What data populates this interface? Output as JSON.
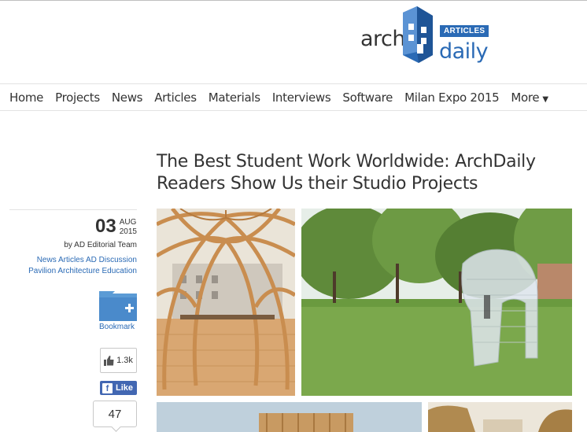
{
  "logo": {
    "word1": "arch",
    "word2": "daily",
    "badge": "ARTICLES",
    "icon": "archdaily-building-icon",
    "brand_color": "#2a6ab5"
  },
  "nav": {
    "items": [
      "Home",
      "Projects",
      "News",
      "Articles",
      "Materials",
      "Interviews",
      "Software",
      "Milan Expo 2015"
    ],
    "more": "More",
    "more_icon": "triangle-down-icon"
  },
  "article": {
    "title": "The Best Student Work Worldwide: ArchDaily Readers Show Us their Studio Projects",
    "date_day": "03",
    "date_month": "AUG",
    "date_year": "2015",
    "author": "by AD Editorial Team",
    "tags": [
      "News",
      "Articles",
      "AD Discussion",
      "Pavilion",
      "Architecture Education"
    ]
  },
  "actions": {
    "bookmark_label": "Bookmark",
    "bookmark_icon": "folder-plus-icon",
    "like_count": "1.3k",
    "like_icon": "thumbs-up-icon",
    "fb_like_label": "Like",
    "fb_icon": "facebook-icon",
    "comment_count": "47"
  }
}
